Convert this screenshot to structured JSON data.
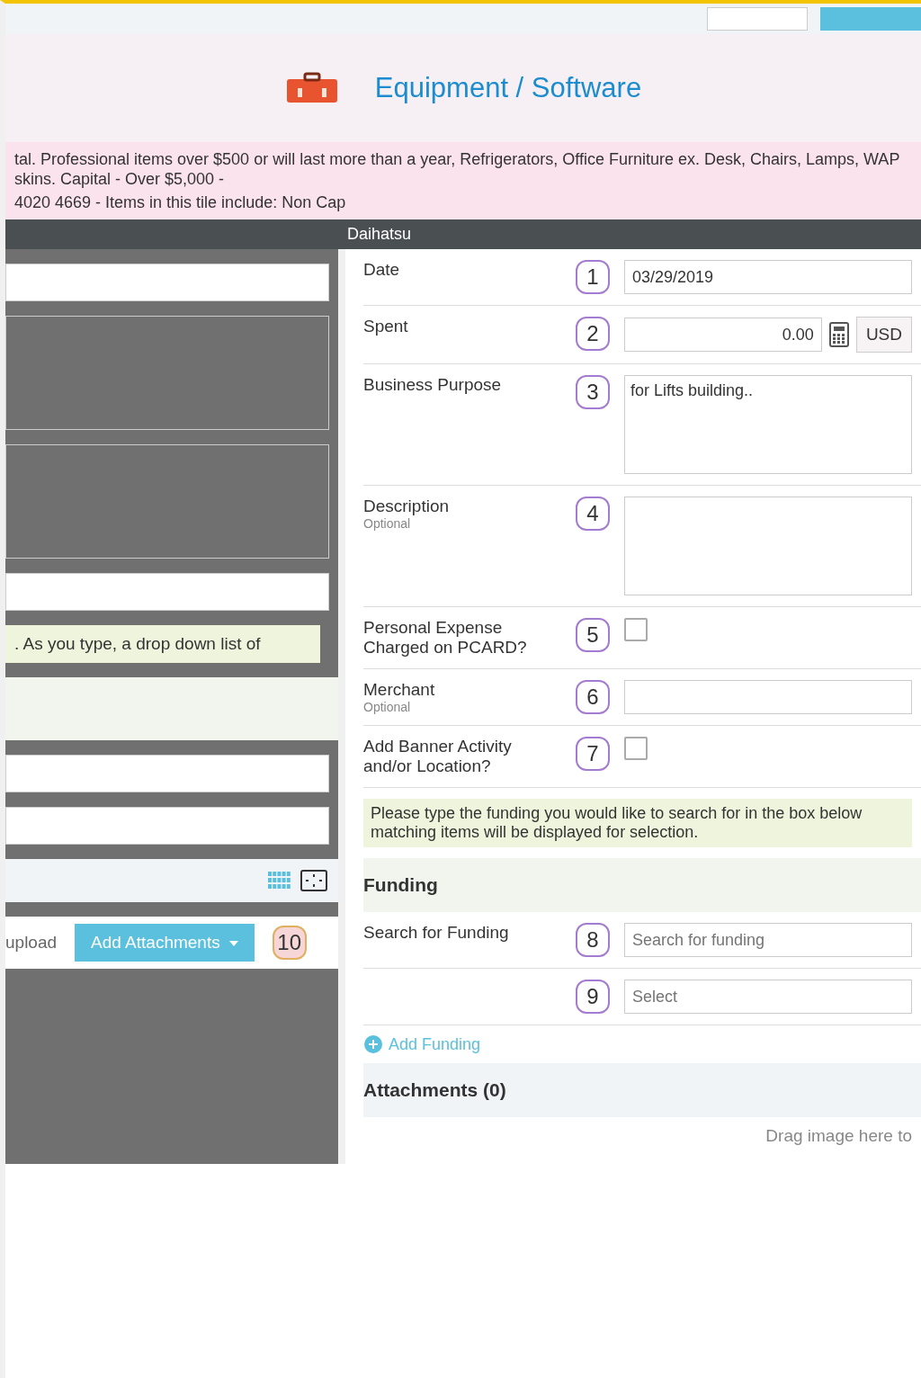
{
  "header": {
    "title": "Equipment / Software"
  },
  "info": {
    "text": "tal. Professional items over $500 or will last more than a year, Refrigerators, Office Furniture ex. Desk, Chairs, Lamps, WAP skins. Capital - Over $5,000 -",
    "code_text": "4020 4669 - Items in this tile include: Non Cap"
  },
  "merchant_value": "Daihatsu",
  "fields": [
    {
      "kind": "date",
      "number": "1",
      "label": "Date",
      "value": "03/29/2019"
    },
    {
      "kind": "amount",
      "number": "2",
      "label": "Spent",
      "value": "0.00",
      "currency": "USD"
    },
    {
      "kind": "textarea",
      "number": "3",
      "label": "Business Purpose",
      "value": "for Lifts building.."
    },
    {
      "kind": "textarea",
      "number": "4",
      "label": "Description",
      "hint": "Optional"
    },
    {
      "kind": "checkbox",
      "number": "5",
      "label": "Personal Expense Charged on PCARD?",
      "checked": false
    },
    {
      "kind": "select",
      "number": "6",
      "label": "Merchant",
      "hint": "Optional"
    },
    {
      "kind": "checkbox",
      "number": "7",
      "label": "Add Banner Activity and/or Location?",
      "checked": false
    }
  ],
  "left_note": ". As you type, a drop down list of",
  "funding": {
    "note": "Please type the funding you would like to search for in the box below matching items will be displayed for selection.",
    "heading": "Funding",
    "search": {
      "number": "8",
      "label": "Search for Funding",
      "placeholder": "Search for funding"
    },
    "select": {
      "number": "9",
      "placeholder": "Select"
    },
    "add_label": "Add Funding"
  },
  "attachments": {
    "heading": "Attachments (0)",
    "upload_text": "upload",
    "button": "Add Attachments",
    "number": "10",
    "drop_hint": "Drag image here to"
  }
}
